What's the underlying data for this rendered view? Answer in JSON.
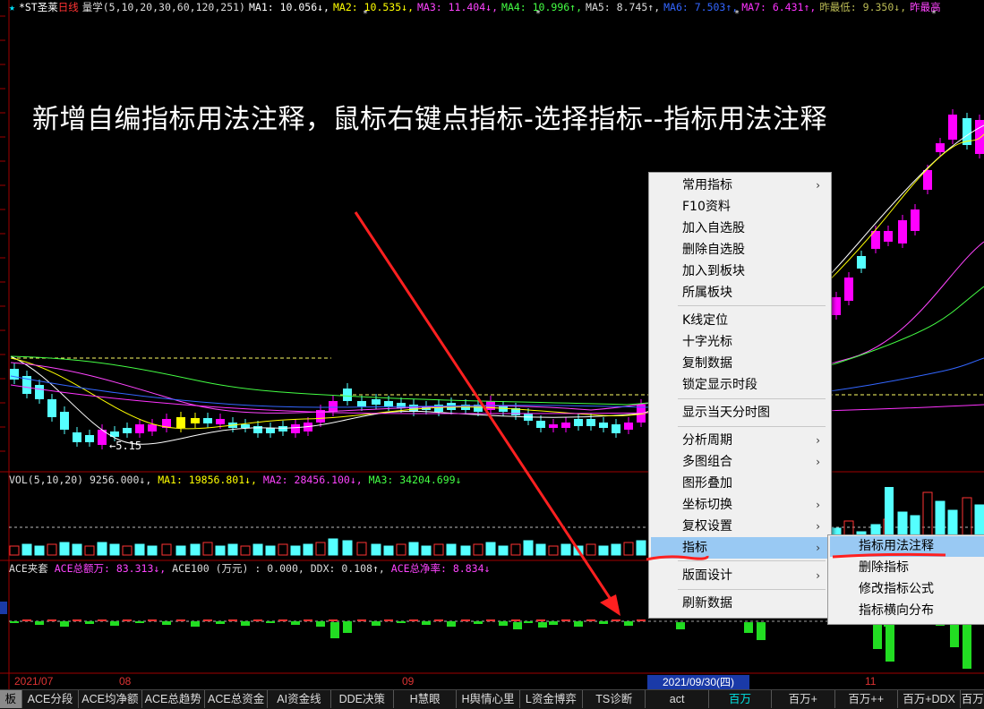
{
  "header": {
    "star": "★",
    "stock_name": "*ST圣莱",
    "period": "日线",
    "indicator": "量学(5,10,20,30,60,120,251)",
    "ma1": "MA1: 10.056↓,",
    "ma2": "MA2: 10.535↓,",
    "ma3": "MA3: 11.404↓,",
    "ma4": "MA4: 10.996↑,",
    "ma5": "MA5: 8.745↑,",
    "ma6": "MA6: 7.503↑,",
    "ma7": "MA7: 6.431↑,",
    "low_label": "昨最低: 9.350↓,",
    "high_label": "昨最高"
  },
  "annotation_text": "新增自编指标用法注释，鼠标右键点指标-选择指标--指标用法注释",
  "low_marker": "←5.15",
  "vol_header": {
    "title": "VOL(5,10,20) 9256.000↓,",
    "ma1": "MA1: 19856.801↓,",
    "ma2": "MA2: 28456.100↓,",
    "ma3": "MA3: 34204.699↓"
  },
  "ace_header": {
    "title": "ACE夹套",
    "amount": "ACE总额万: 83.313↓,",
    "ace100": "ACE100 (万元) : 0.000,",
    "ddx": "DDX: 0.108↑,",
    "net_rate": "ACE总净率: 8.834↓"
  },
  "dates": {
    "d1": "2021/07",
    "d2": "08",
    "d3": "09",
    "d4": "11",
    "cursor": "2021/09/30(四)"
  },
  "context_menu": {
    "items": [
      {
        "label": "常用指标",
        "arrow": "›"
      },
      {
        "label": "F10资料",
        "arrow": ""
      },
      {
        "label": "加入自选股",
        "arrow": ""
      },
      {
        "label": "删除自选股",
        "arrow": ""
      },
      {
        "label": "加入到板块",
        "arrow": ""
      },
      {
        "label": "所属板块",
        "arrow": ""
      },
      {
        "label": "K线定位",
        "arrow": ""
      },
      {
        "label": "十字光标",
        "arrow": ""
      },
      {
        "label": "复制数据",
        "arrow": ""
      },
      {
        "label": "锁定显示时段",
        "arrow": ""
      },
      {
        "label": "显示当天分时图",
        "arrow": ""
      },
      {
        "label": "分析周期",
        "arrow": "›"
      },
      {
        "label": "多图组合",
        "arrow": "›"
      },
      {
        "label": "图形叠加",
        "arrow": ""
      },
      {
        "label": "坐标切换",
        "arrow": "›"
      },
      {
        "label": "复权设置",
        "arrow": "›"
      },
      {
        "label": "指标",
        "arrow": "›"
      },
      {
        "label": "版面设计",
        "arrow": "›"
      },
      {
        "label": "刷新数据",
        "arrow": ""
      }
    ]
  },
  "sub_menu": {
    "items": [
      {
        "label": "指标用法注释"
      },
      {
        "label": "删除指标"
      },
      {
        "label": "修改指标公式"
      },
      {
        "label": "指标横向分布"
      }
    ]
  },
  "bottom_tabs": [
    {
      "label": "板"
    },
    {
      "label": "ACE分段"
    },
    {
      "label": "ACE均净额"
    },
    {
      "label": "ACE总趋势"
    },
    {
      "label": "ACE总资金"
    },
    {
      "label": "AI资金线"
    },
    {
      "label": "DDE决策"
    },
    {
      "label": "H慧眼"
    },
    {
      "label": "H舆情心里"
    },
    {
      "label": "L资金博弈"
    },
    {
      "label": "TS诊断"
    },
    {
      "label": "act"
    },
    {
      "label": "百万"
    },
    {
      "label": "百万+"
    },
    {
      "label": "百万++"
    },
    {
      "label": "百万+DDX"
    },
    {
      "label": "百万"
    }
  ],
  "colors": {
    "up": "#ff00ff",
    "down": "#55ffff",
    "vol_up": "#ff3333",
    "green": "#22dd22",
    "arrow": "#ff2020",
    "menu_selected": "#99c9f3"
  }
}
